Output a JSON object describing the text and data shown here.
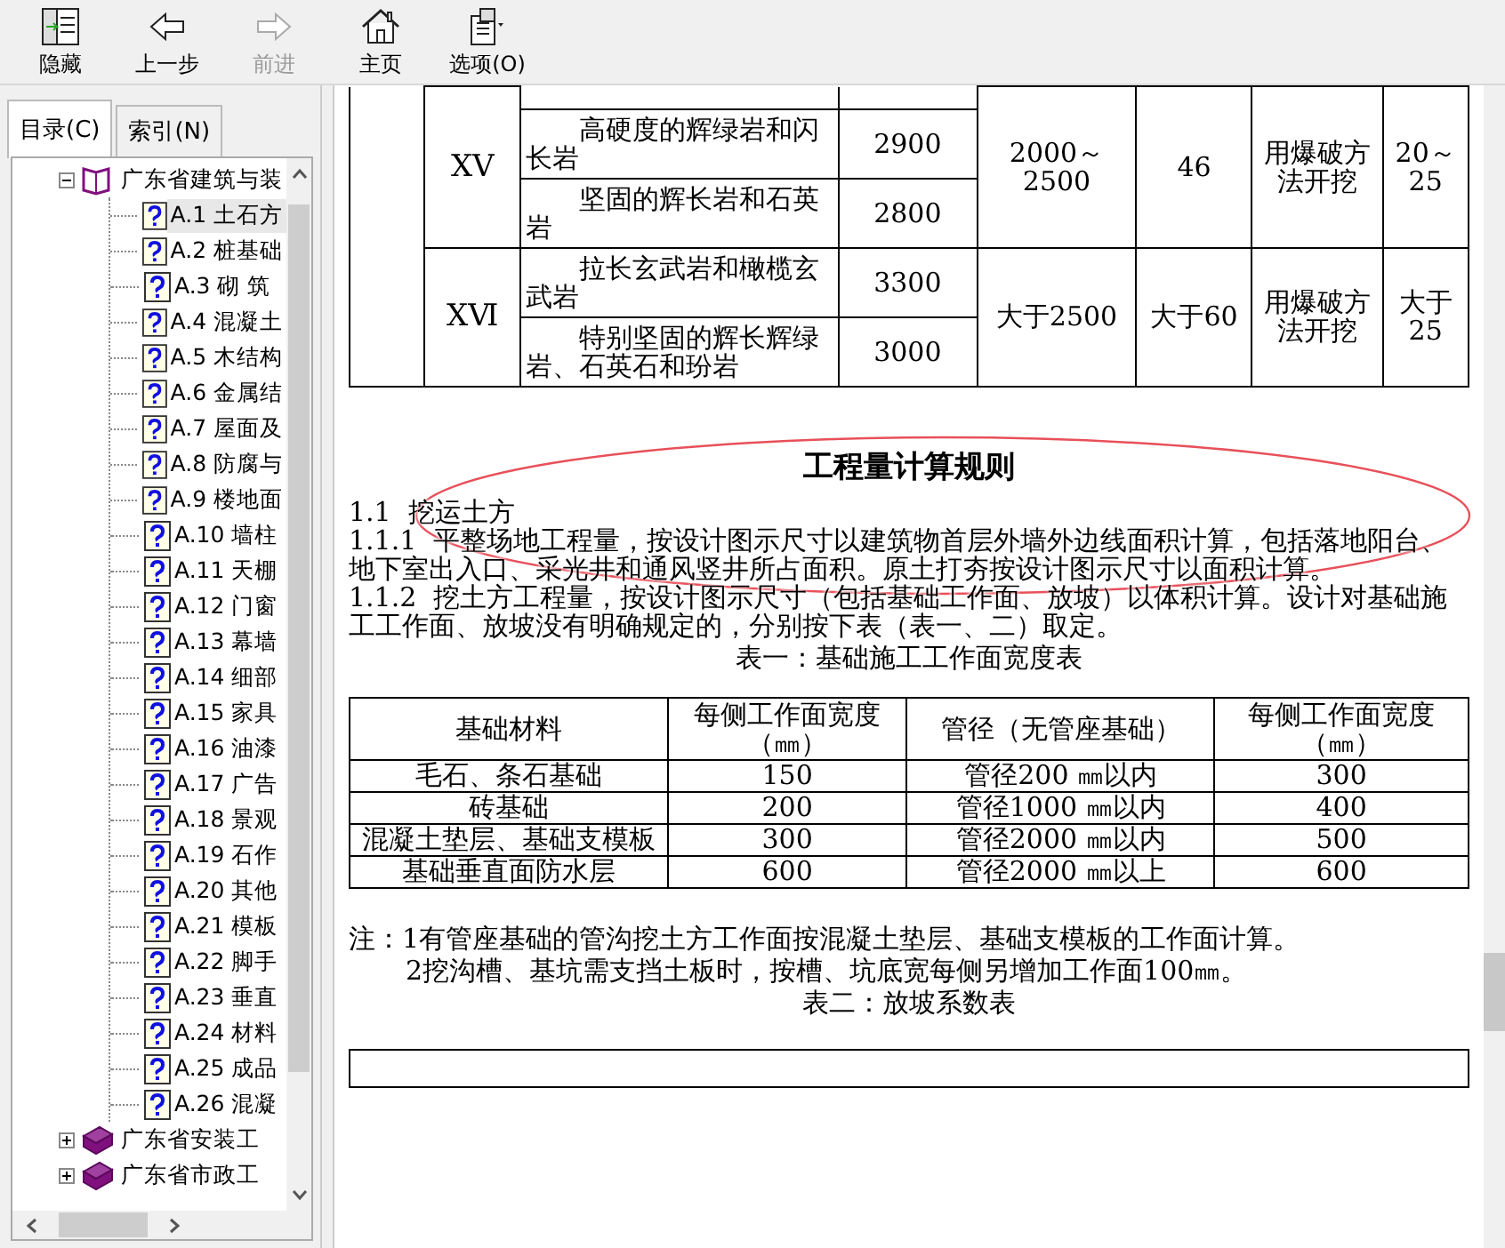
{
  "toolbar": [
    {
      "label": "隐藏",
      "kind": "hide",
      "disabled": false
    },
    {
      "label": "上一步",
      "kind": "back",
      "disabled": false
    },
    {
      "label": "前进",
      "kind": "forward",
      "disabled": true
    },
    {
      "label": "主页",
      "kind": "home",
      "disabled": false
    },
    {
      "label": "选项(O)",
      "kind": "options",
      "disabled": false
    }
  ],
  "nav_tabs": [
    {
      "label": "目录(C)",
      "selected": true
    },
    {
      "label": "索引(N)",
      "selected": false
    }
  ],
  "tree": [
    {
      "label": "广东省建筑与装",
      "expanded": true,
      "children": [
        {
          "label": "A.1  土石方",
          "selected": true
        },
        {
          "label": "A.2  桩基础",
          "selected": false
        },
        {
          "label": "A.3  砌  筑",
          "selected": false
        },
        {
          "label": "A.4  混凝土",
          "selected": false
        },
        {
          "label": "A.5  木结构",
          "selected": false
        },
        {
          "label": "A.6  金属结",
          "selected": false
        },
        {
          "label": "A.7 屋面及",
          "selected": false
        },
        {
          "label": "A.8  防腐与",
          "selected": false
        },
        {
          "label": "A.9  楼地面",
          "selected": false
        },
        {
          "label": "A.10  墙柱",
          "selected": false
        },
        {
          "label": "A.11  天棚",
          "selected": false
        },
        {
          "label": "A.12  门窗",
          "selected": false
        },
        {
          "label": "A.13  幕墙",
          "selected": false
        },
        {
          "label": "A.14  细部",
          "selected": false
        },
        {
          "label": "A.15  家具",
          "selected": false
        },
        {
          "label": "A.16  油漆",
          "selected": false
        },
        {
          "label": "A.17  广告",
          "selected": false
        },
        {
          "label": "A.18 景观",
          "selected": false
        },
        {
          "label": "A.19 石作",
          "selected": false
        },
        {
          "label": "A.20  其他",
          "selected": false
        },
        {
          "label": "A.21  模板",
          "selected": false
        },
        {
          "label": "A.22  脚手",
          "selected": false
        },
        {
          "label": "A.23  垂直",
          "selected": false
        },
        {
          "label": "A.24  材料",
          "selected": false
        },
        {
          "label": "A.25  成品",
          "selected": false
        },
        {
          "label": "A.26  混凝",
          "selected": false
        }
      ]
    },
    {
      "label": "广东省安装工",
      "expanded": false
    },
    {
      "label": "广东省市政工",
      "expanded": false
    }
  ],
  "rock_table": {
    "groups": [
      {
        "column_2": "ⅩⅤ",
        "column_5": "2000～2500",
        "column_6": "46",
        "column_7": "用爆破方法开挖",
        "column_8": "20～25",
        "items": [
          {
            "kind": "partial"
          },
          {
            "kind": "row",
            "column_3": "高硬度的辉绿岩和闪长岩",
            "column_4": "2900"
          },
          {
            "kind": "row",
            "column_3": "坚固的辉长岩和石英岩",
            "column_4": "2800"
          }
        ]
      },
      {
        "column_2": "ⅩⅥ",
        "column_5": "大于2500",
        "column_6": "大于60",
        "column_7": "用爆破方法开挖",
        "column_8": "大于25",
        "items": [
          {
            "kind": "row",
            "column_3": "拉长玄武岩和橄榄玄武岩",
            "column_4": "3300"
          },
          {
            "kind": "row",
            "column_3": "特别坚固的辉长辉绿岩、石英石和玢岩",
            "column_4": "3000"
          }
        ]
      }
    ]
  },
  "heading": "工程量计算规则",
  "paragraphs": [
    "1.1  挖运土方",
    "1.1.1  平整场地工程量，按设计图示尺寸以建筑物首层外墙外边线面积计算，包括落地阳台、地下室出入口、采光井和通风竖井所占面积。原土打夯按设计图示尺寸以面积计算。",
    "1.1.2  挖土方工程量，按设计图示尺寸（包括基础工作面、放坡）以体积计算。设计对基础施工工作面、放坡没有明确规定的，分别按下表（表一、二）取定。"
  ],
  "markup": [
    {
      "kind": "ellipse",
      "color": "#e8505a"
    }
  ],
  "table_1": {
    "caption": "表一：基础施工工作面宽度表",
    "columns": [
      "基础材料",
      "每侧工作面宽度（㎜）",
      "管径（无管座基础）",
      "每侧工作面宽度（㎜）"
    ],
    "rows": [
      [
        "毛石、条石基础",
        "150",
        "管径200 ㎜以内",
        "300"
      ],
      [
        "砖基础",
        "200",
        "管径1000 ㎜以内",
        "400"
      ],
      [
        "混凝土垫层、基础支模板",
        "300",
        "管径2000 ㎜以内",
        "500"
      ],
      [
        "基础垂直面防水层",
        "600",
        "管径2000 ㎜以上",
        "600"
      ]
    ]
  },
  "notes": [
    "注：1有管座基础的管沟挖土方工作面按混凝土垫层、基础支模板的工作面计算。",
    "2挖沟槽、基坑需支挡土板时，按槽、坑底宽每侧另增加工作面100㎜。"
  ],
  "table_2": {
    "caption": "表二：放坡系数表"
  }
}
